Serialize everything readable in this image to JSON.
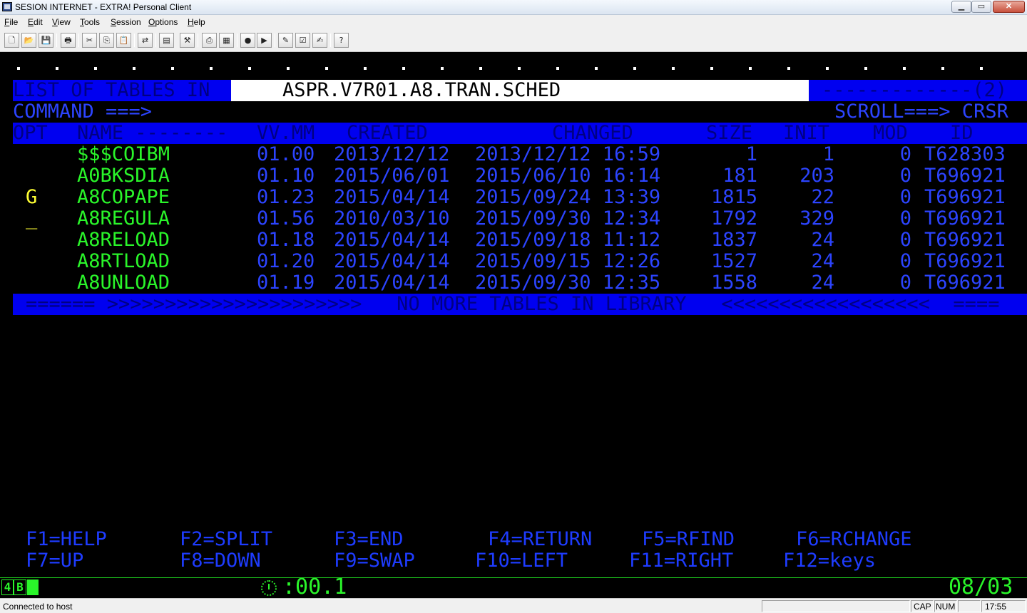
{
  "window": {
    "title": "SESION INTERNET - EXTRA! Personal Client",
    "min_glyph": "▁",
    "max_glyph": "▭",
    "close_glyph": "✕"
  },
  "menu": [
    "File",
    "Edit",
    "View",
    "Tools",
    "Session",
    "Options",
    "Help"
  ],
  "toolbar_icons": [
    "new-icon",
    "open-icon",
    "save-icon",
    "print-icon",
    "cut-icon",
    "copy-icon",
    "paste-icon",
    "transfer-icon",
    "clipboard-icon",
    "tools-icon",
    "print-screen-icon",
    "page-setup-icon",
    "connect-icon",
    "macro-icon",
    "edit-quickpad-icon",
    "quickpad-icon",
    "hotspot-icon",
    "help-icon"
  ],
  "toolbar_glyphs": [
    "🗋",
    "📂",
    "💾",
    "🖶",
    "✂",
    "⎘",
    "📋",
    "⇄",
    "▤",
    "⚒",
    "⎙",
    "▦",
    "●",
    "▶",
    "✎",
    "☑",
    "✍",
    "?"
  ],
  "terminal": {
    "header_left": "LIST OF TABLES IN",
    "library": "ASPR.V7R01.A8.TRAN.SCHED",
    "header_right": "-------------(2)",
    "command_label": "COMMAND ===>",
    "scroll_label": "SCROLL===> CRSR",
    "columns": {
      "opt": "OPT",
      "name": "NAME --------",
      "vvmm": "VV.MM",
      "created": "CREATED",
      "changed": "CHANGED",
      "size": "SIZE",
      "init": "INIT",
      "mod": "MOD",
      "id": "ID"
    },
    "rows": [
      {
        "opt": "",
        "name": "$$$COIBM",
        "vvmm": "01.00",
        "created": "2013/12/12",
        "changed": "2013/12/12 16:59",
        "size": "1",
        "init": "1",
        "mod": "0",
        "id": "T628303"
      },
      {
        "opt": "",
        "name": "A0BKSDIA",
        "vvmm": "01.10",
        "created": "2015/06/01",
        "changed": "2015/06/10 16:14",
        "size": "181",
        "init": "203",
        "mod": "0",
        "id": "T696921"
      },
      {
        "opt": "G",
        "name": "A8COPAPE",
        "vvmm": "01.23",
        "created": "2015/04/14",
        "changed": "2015/09/24 13:39",
        "size": "1815",
        "init": "22",
        "mod": "0",
        "id": "T696921"
      },
      {
        "opt": "_",
        "name": "A8REGULA",
        "vvmm": "01.56",
        "created": "2010/03/10",
        "changed": "2015/09/30 12:34",
        "size": "1792",
        "init": "329",
        "mod": "0",
        "id": "T696921"
      },
      {
        "opt": "",
        "name": "A8RELOAD",
        "vvmm": "01.18",
        "created": "2015/04/14",
        "changed": "2015/09/18 11:12",
        "size": "1837",
        "init": "24",
        "mod": "0",
        "id": "T696921"
      },
      {
        "opt": "",
        "name": "A8RTLOAD",
        "vvmm": "01.20",
        "created": "2015/04/14",
        "changed": "2015/09/15 12:26",
        "size": "1527",
        "init": "24",
        "mod": "0",
        "id": "T696921"
      },
      {
        "opt": "",
        "name": "A8UNLOAD",
        "vvmm": "01.19",
        "created": "2015/04/14",
        "changed": "2015/09/30 12:35",
        "size": "1558",
        "init": "24",
        "mod": "0",
        "id": "T696921"
      }
    ],
    "footer": "====== >>>>>>>>>>>>>>>>>>>>>>   NO MORE TABLES IN LIBRARY   <<<<<<<<<<<<<<<<<<  ====",
    "fkeys_row1": [
      "F1=HELP",
      "F2=SPLIT",
      "F3=END",
      "F4=RETURN",
      "F5=RFIND",
      "F6=RCHANGE"
    ],
    "fkeys_row2": [
      "F7=UP",
      "F8=DOWN",
      "F9=SWAP",
      "F10=LEFT",
      "F11=RIGHT",
      "F12=keys"
    ]
  },
  "oia": {
    "session_num": "4",
    "session_letter": "B",
    "response_time": ":00.1",
    "cursor_pos": "08/03"
  },
  "status": {
    "message": "Connected to host",
    "cap": "CAP",
    "num": "NUM",
    "time": "17:55"
  },
  "colors": {
    "field_blue": "#0000f0",
    "text_green": "#2af52a",
    "text_yellow": "#ffff33",
    "fkey_blue": "#1e3cff"
  }
}
